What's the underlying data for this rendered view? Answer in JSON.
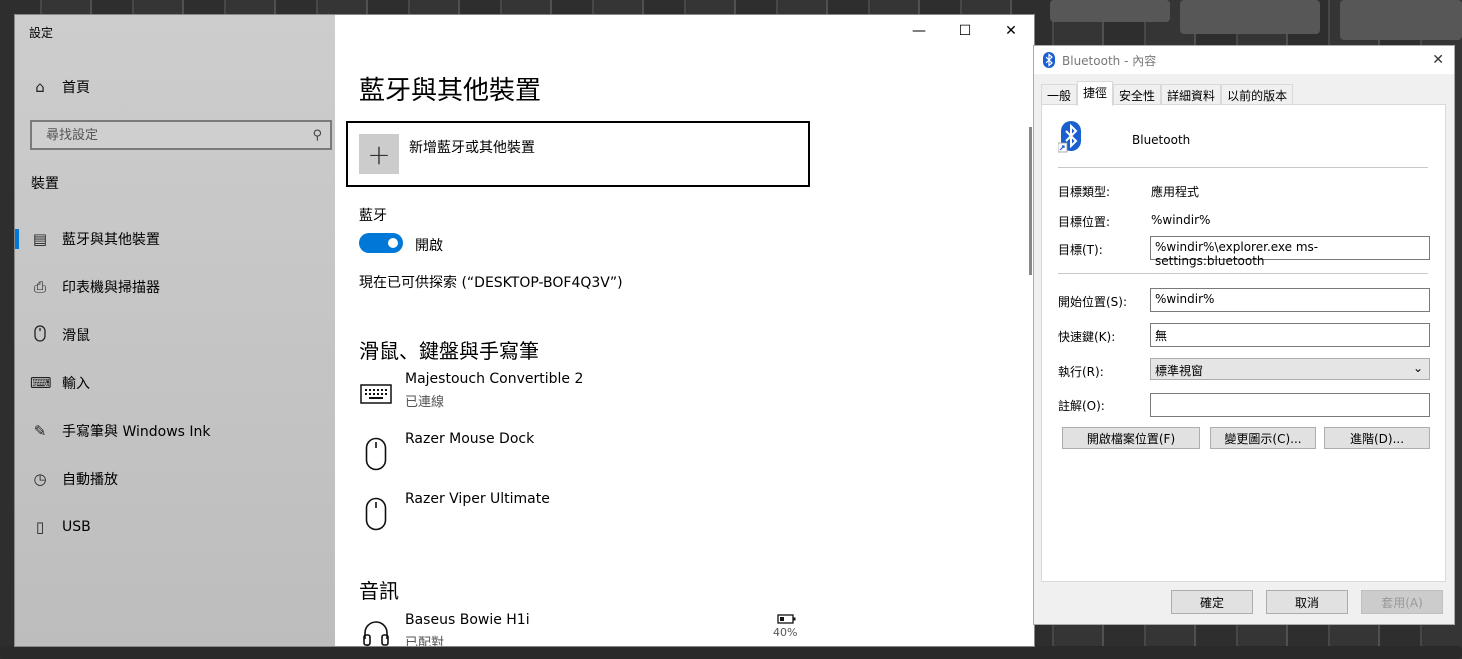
{
  "settings": {
    "app_title": "設定",
    "home": "首頁",
    "search_placeholder": "尋找設定",
    "group_title": "裝置",
    "nav": [
      {
        "label": "藍牙與其他裝置",
        "icon": "bluetooth-devices-icon"
      },
      {
        "label": "印表機與掃描器",
        "icon": "printer-icon"
      },
      {
        "label": "滑鼠",
        "icon": "mouse-icon"
      },
      {
        "label": "輸入",
        "icon": "keyboard-icon"
      },
      {
        "label": "手寫筆與 Windows Ink",
        "icon": "pen-icon"
      },
      {
        "label": "自動播放",
        "icon": "autoplay-icon"
      },
      {
        "label": "USB",
        "icon": "usb-icon"
      }
    ],
    "page_title": "藍牙與其他裝置",
    "add_device": "新增藍牙或其他裝置",
    "bt_label": "藍牙",
    "bt_toggle": "開啟",
    "discoverable": "現在已可供探索 (“DESKTOP-BOF4Q3V”)",
    "section_input": "滑鼠、鍵盤與手寫筆",
    "devices": [
      {
        "name": "Majestouch Convertible 2",
        "status": "已連線",
        "icon": "keyboard-icon"
      },
      {
        "name": "Razer Mouse Dock",
        "status": "",
        "icon": "mouse-icon"
      },
      {
        "name": "Razer Viper Ultimate",
        "status": "",
        "icon": "mouse-icon"
      }
    ],
    "section_audio": "音訊",
    "audio_device": {
      "name": "Baseus Bowie H1i",
      "status": "已配對",
      "battery": "40%",
      "icon": "headset-icon"
    }
  },
  "dialog": {
    "title": "Bluetooth - 內容",
    "tabs": [
      "一般",
      "捷徑",
      "安全性",
      "詳細資料",
      "以前的版本"
    ],
    "selected_tab": "捷徑",
    "name": "Bluetooth",
    "target_type_label": "目標類型:",
    "target_type": "應用程式",
    "target_location_label": "目標位置:",
    "target_location": "%windir%",
    "target_label": "目標(T):",
    "target": "%windir%\\explorer.exe ms-settings:bluetooth",
    "start_in_label": "開始位置(S):",
    "start_in": "%windir%",
    "shortcut_key_label": "快速鍵(K):",
    "shortcut_key": "無",
    "run_label": "執行(R):",
    "run": "標準視窗",
    "comment_label": "註解(O):",
    "comment": "",
    "open_location": "開啟檔案位置(F)",
    "change_icon": "變更圖示(C)...",
    "advanced": "進階(D)...",
    "ok": "確定",
    "cancel": "取消",
    "apply": "套用(A)"
  },
  "colors": {
    "accent": "#0078d7",
    "bt_blue": "#1a5fd0"
  }
}
